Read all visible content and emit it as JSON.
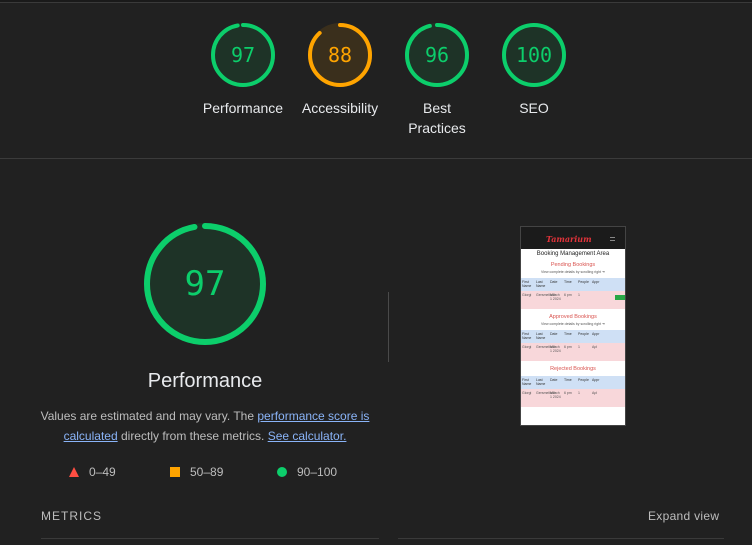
{
  "summary": [
    {
      "score": "97",
      "score_value": 97,
      "label": "Performance",
      "color": "#0cce6b",
      "bg": "#1e3327"
    },
    {
      "score": "88",
      "score_value": 88,
      "label": "Accessibility",
      "color": "#ffa400",
      "bg": "#3a2f1c"
    },
    {
      "score": "96",
      "score_value": 96,
      "label": "Best Practices",
      "color": "#0cce6b",
      "bg": "#1e3327"
    },
    {
      "score": "100",
      "score_value": 100,
      "label": "SEO",
      "color": "#0cce6b",
      "bg": "#1e3327"
    }
  ],
  "main": {
    "score": "97",
    "score_value": 97,
    "title": "Performance",
    "desc_prefix": "Values are estimated and may vary. The ",
    "desc_link1": "performance score is calculated",
    "desc_middle": " directly from these metrics. ",
    "desc_link2": "See calculator."
  },
  "legend": [
    {
      "range": "0–49",
      "icon": "triangle-icon",
      "color": "#ff4e42"
    },
    {
      "range": "50–89",
      "icon": "square-icon",
      "color": "#ffa400"
    },
    {
      "range": "90–100",
      "icon": "circle-icon",
      "color": "#0cce6b"
    }
  ],
  "thumbnail": {
    "brand": "Tamarium",
    "heading": "Booking Management Area",
    "sections": [
      {
        "title": "Pending Bookings",
        "sub": "View complete details by scrolling right ➔"
      },
      {
        "title": "Approved Bookings",
        "sub": "View complete details by scrolling right ➔"
      },
      {
        "title": "Rejected Bookings",
        "sub": ""
      }
    ],
    "columns": [
      "First Name",
      "Last Name",
      "Date",
      "Time",
      "People",
      "Appr"
    ],
    "row": [
      "Giorgi",
      "Gersmelia4h",
      "March 1 2024",
      "6 pm",
      "1",
      "Apl"
    ]
  },
  "metrics": {
    "label": "METRICS",
    "expand": "Expand view"
  }
}
